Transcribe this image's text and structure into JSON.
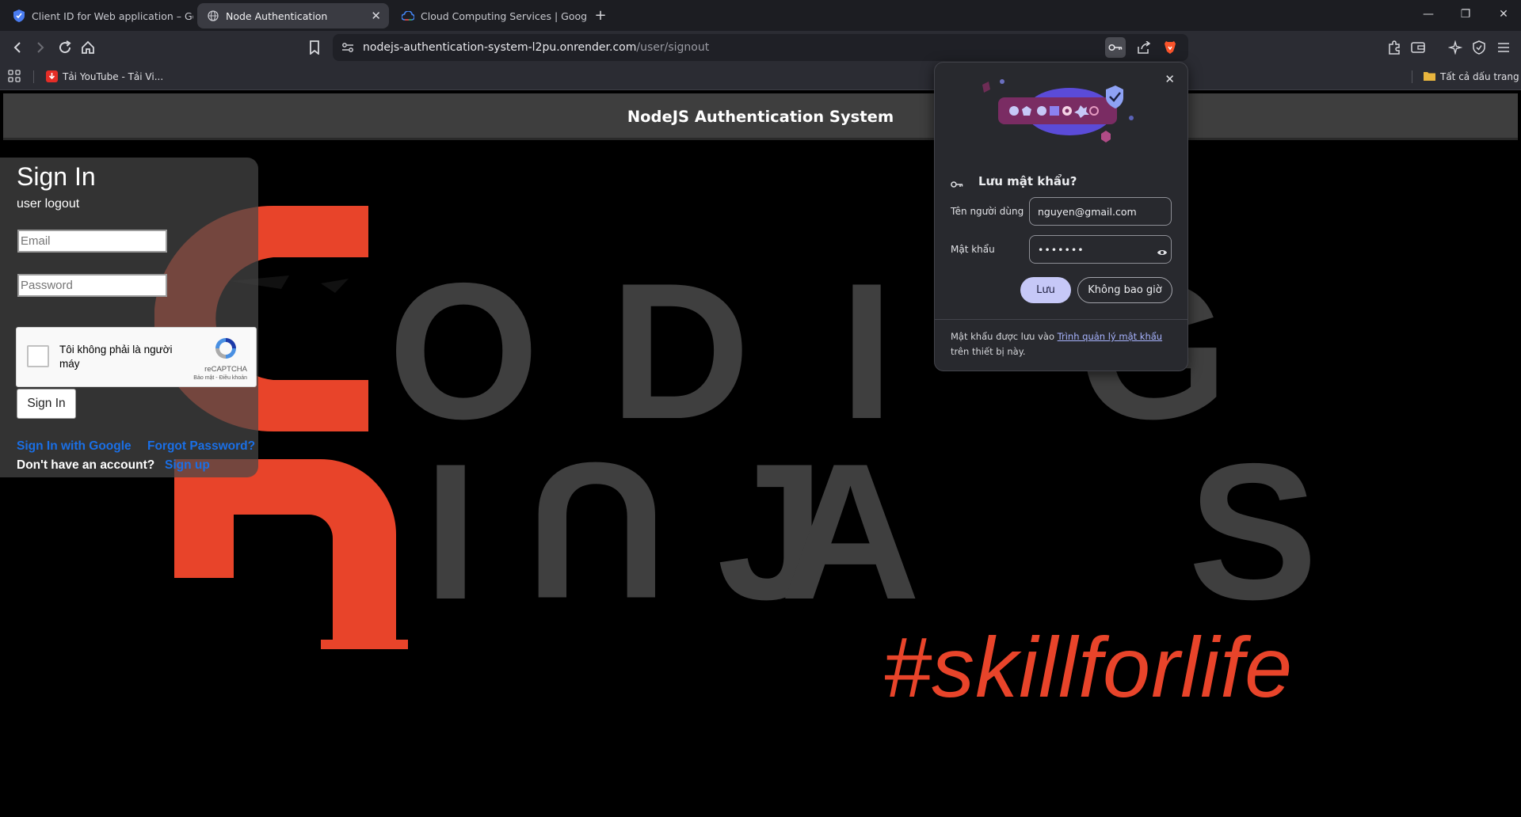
{
  "browser": {
    "tabs": [
      {
        "title": "Client ID for Web application – Goog",
        "icon": "shield-icon"
      },
      {
        "title": "Node Authentication",
        "icon": "globe-icon"
      },
      {
        "title": "Cloud Computing Services | Google C",
        "icon": "google-cloud-icon"
      }
    ],
    "new_tab": "+",
    "tab_close": "✕",
    "url_host": "nodejs-authentication-system-l2pu.onrender.com",
    "url_path": "/user/signout",
    "bookmarks": [
      {
        "label": "Tải YouTube - Tải Vi...",
        "icon": "download-icon"
      }
    ],
    "all_bookmarks": "Tất cả dấu trang",
    "colors": {
      "brave_orange": "#fb542b",
      "tab_bar": "#1c1d22",
      "toolbar": "#2b2c33"
    }
  },
  "site": {
    "header_title": "NodeJS Authentication System",
    "background_letters": [
      "C",
      "O",
      "D",
      "I",
      "N",
      "G",
      "N",
      "I",
      "N",
      "J",
      "A",
      "S"
    ],
    "tagline": "#skillforlife",
    "colors": {
      "brand_orange": "#e8442a",
      "letters_gray": "#3f3f3f"
    }
  },
  "signin": {
    "title": "Sign In",
    "status": "user logout",
    "email_placeholder": "Email",
    "password_placeholder": "Password",
    "recaptcha_text": "Tôi không phải là người máy",
    "recaptcha_brand": "reCAPTCHA",
    "recaptcha_terms": "Bảo mật - Điều khoản",
    "button": "Sign In",
    "google_link": "Sign In with Google",
    "forgot_link": "Forgot Password?",
    "no_account": "Don't have an account?",
    "signup_link": "Sign up",
    "colors": {
      "link": "#1a6fe6"
    }
  },
  "password_popup": {
    "title": "Lưu mật khẩu?",
    "username_label": "Tên người dùng",
    "username_value": "nguyen@gmail.com",
    "password_label": "Mật khẩu",
    "password_value": "•••••••",
    "save_button": "Lưu",
    "never_button": "Không bao giờ",
    "footer_before": "Mật khẩu được lưu vào ",
    "footer_link": "Trình quản lý mật khẩu",
    "footer_after": " trên thiết bị này.",
    "close": "✕",
    "colors": {
      "save_bg": "#c6c8f7",
      "illustration": "#5b4bd8"
    }
  }
}
